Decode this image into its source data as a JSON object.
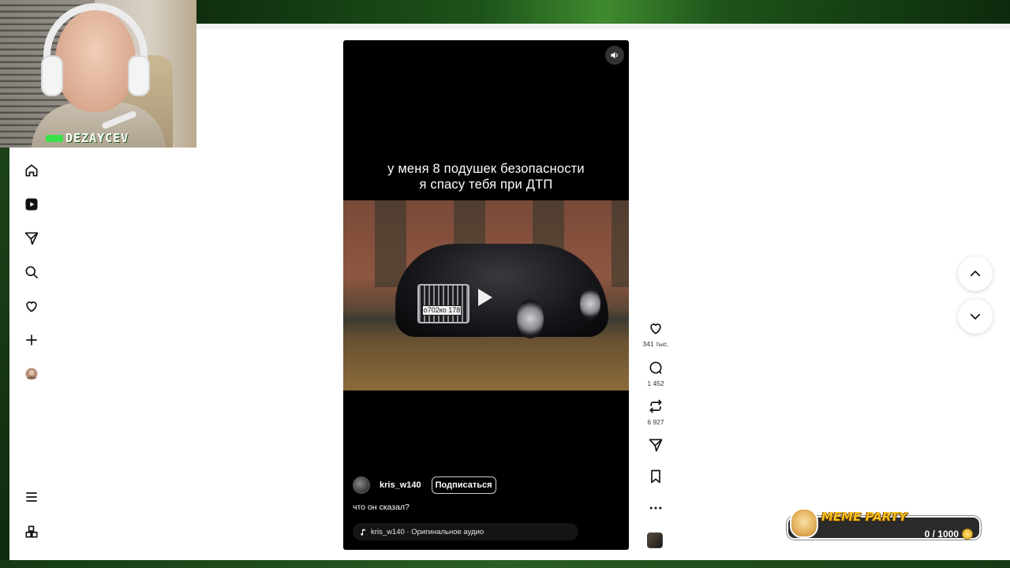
{
  "stream": {
    "streamer_tag": "DEZAYCEV"
  },
  "sidebar": {
    "items": [
      {
        "icon": "home-icon"
      },
      {
        "icon": "reels-icon"
      },
      {
        "icon": "send-icon"
      },
      {
        "icon": "search-icon"
      },
      {
        "icon": "heart-icon"
      },
      {
        "icon": "plus-icon"
      },
      {
        "icon": "profile-avatar"
      }
    ],
    "bottom": [
      {
        "icon": "menu-icon"
      },
      {
        "icon": "apps-icon"
      }
    ]
  },
  "video": {
    "caption_line1": "у меня 8 подушек безопасности",
    "caption_line2": "я спасу тебя при ДТП",
    "plate": "о702ко 178",
    "author": "kris_w140",
    "subscribe_label": "Подписаться",
    "description": "что он сказал?",
    "audio": "kris_w140 · Оригинальное аудио"
  },
  "actions": {
    "likes": "341 тыс.",
    "comments": "1 452",
    "reposts": "6 927"
  },
  "meme_party": {
    "title": "MEME PARTY",
    "progress_text": "0 / 1000",
    "progress": 0
  },
  "colors": {
    "page_bg": "#ffffff",
    "video_bg": "#000000",
    "stream_green": "#38e04a",
    "meme_gold": "#f6c21e"
  }
}
